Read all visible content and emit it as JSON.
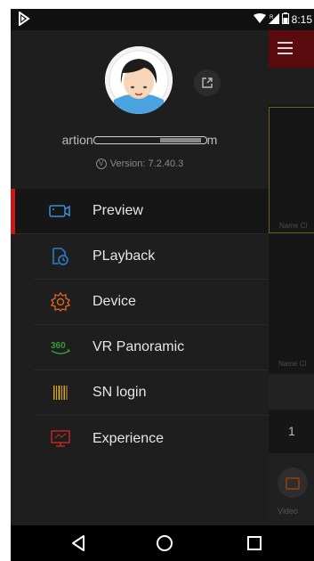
{
  "status_bar": {
    "time": "8:15",
    "left_icon": "notification-icon",
    "icons": [
      "wifi-icon",
      "signal-icon",
      "battery-icon"
    ]
  },
  "drawer": {
    "username_start": "artion",
    "username_end": "m",
    "version": "Version: 7.2.40.3",
    "menu": [
      {
        "label": "Preview",
        "icon": "camera-preview-icon",
        "icon_color": "#3a8fd6",
        "active": true
      },
      {
        "label": "PLayback",
        "icon": "playback-clock-icon",
        "icon_color": "#2f7fd4",
        "active": false
      },
      {
        "label": "Device",
        "icon": "device-gear-icon",
        "icon_color": "#d9631e",
        "active": false
      },
      {
        "label": "VR Panoramic",
        "icon": "vr-360-icon",
        "icon_color": "#2f9e3a",
        "active": false
      },
      {
        "label": "SN login",
        "icon": "barcode-icon",
        "icon_color": "#d6a21c",
        "active": false
      },
      {
        "label": "Experience",
        "icon": "monitor-icon",
        "icon_color": "#c0241d",
        "active": false
      }
    ]
  },
  "background_app": {
    "name_label_1": "Name Cl",
    "name_label_2": "Name Cl",
    "number": "1",
    "video_label": "Video"
  },
  "colors": {
    "accent_red": "#c61b1b",
    "drawer_bg": "#1e1e1e"
  }
}
